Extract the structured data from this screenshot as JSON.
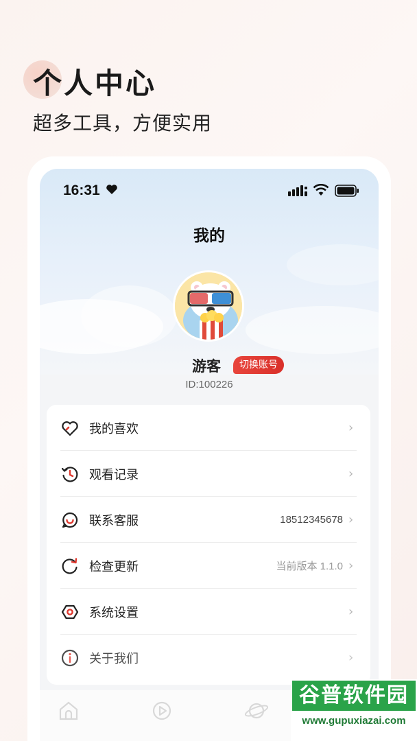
{
  "promo": {
    "title": "个人中心",
    "subtitle": "超多工具，方便实用"
  },
  "status_bar": {
    "time": "16:31",
    "heart_icon": "heart-icon",
    "signal_icon": "signal-icon",
    "wifi_icon": "wifi-icon",
    "battery_icon": "battery-icon"
  },
  "header": {
    "title": "我的"
  },
  "profile": {
    "avatar_icon": "bear-popcorn-avatar",
    "name": "游客",
    "switch_label": "切换账号",
    "id_text": "ID:100226"
  },
  "menu": {
    "items": [
      {
        "label": "我的喜欢",
        "value": "",
        "icon": "heart-outline-icon"
      },
      {
        "label": "观看记录",
        "value": "",
        "icon": "history-icon"
      },
      {
        "label": "联系客服",
        "value": "18512345678",
        "icon": "service-icon"
      },
      {
        "label": "检查更新",
        "value": "当前版本 1.1.0",
        "icon": "refresh-icon"
      },
      {
        "label": "系统设置",
        "value": "",
        "icon": "settings-icon"
      },
      {
        "label": "关于我们",
        "value": "",
        "icon": "info-icon"
      }
    ],
    "chevron": "›"
  },
  "tabbar": {
    "tabs": [
      {
        "icon": "home-icon"
      },
      {
        "icon": "play-icon"
      },
      {
        "icon": "planet-icon"
      },
      {
        "icon": "profile-icon"
      }
    ]
  },
  "watermark": {
    "logo": "谷普软件园",
    "url": "www.gupuxiazai.com"
  },
  "colors": {
    "accent": "#e0392f",
    "card_bg": "#ffffff",
    "page_bg": "#f4f5f7"
  }
}
